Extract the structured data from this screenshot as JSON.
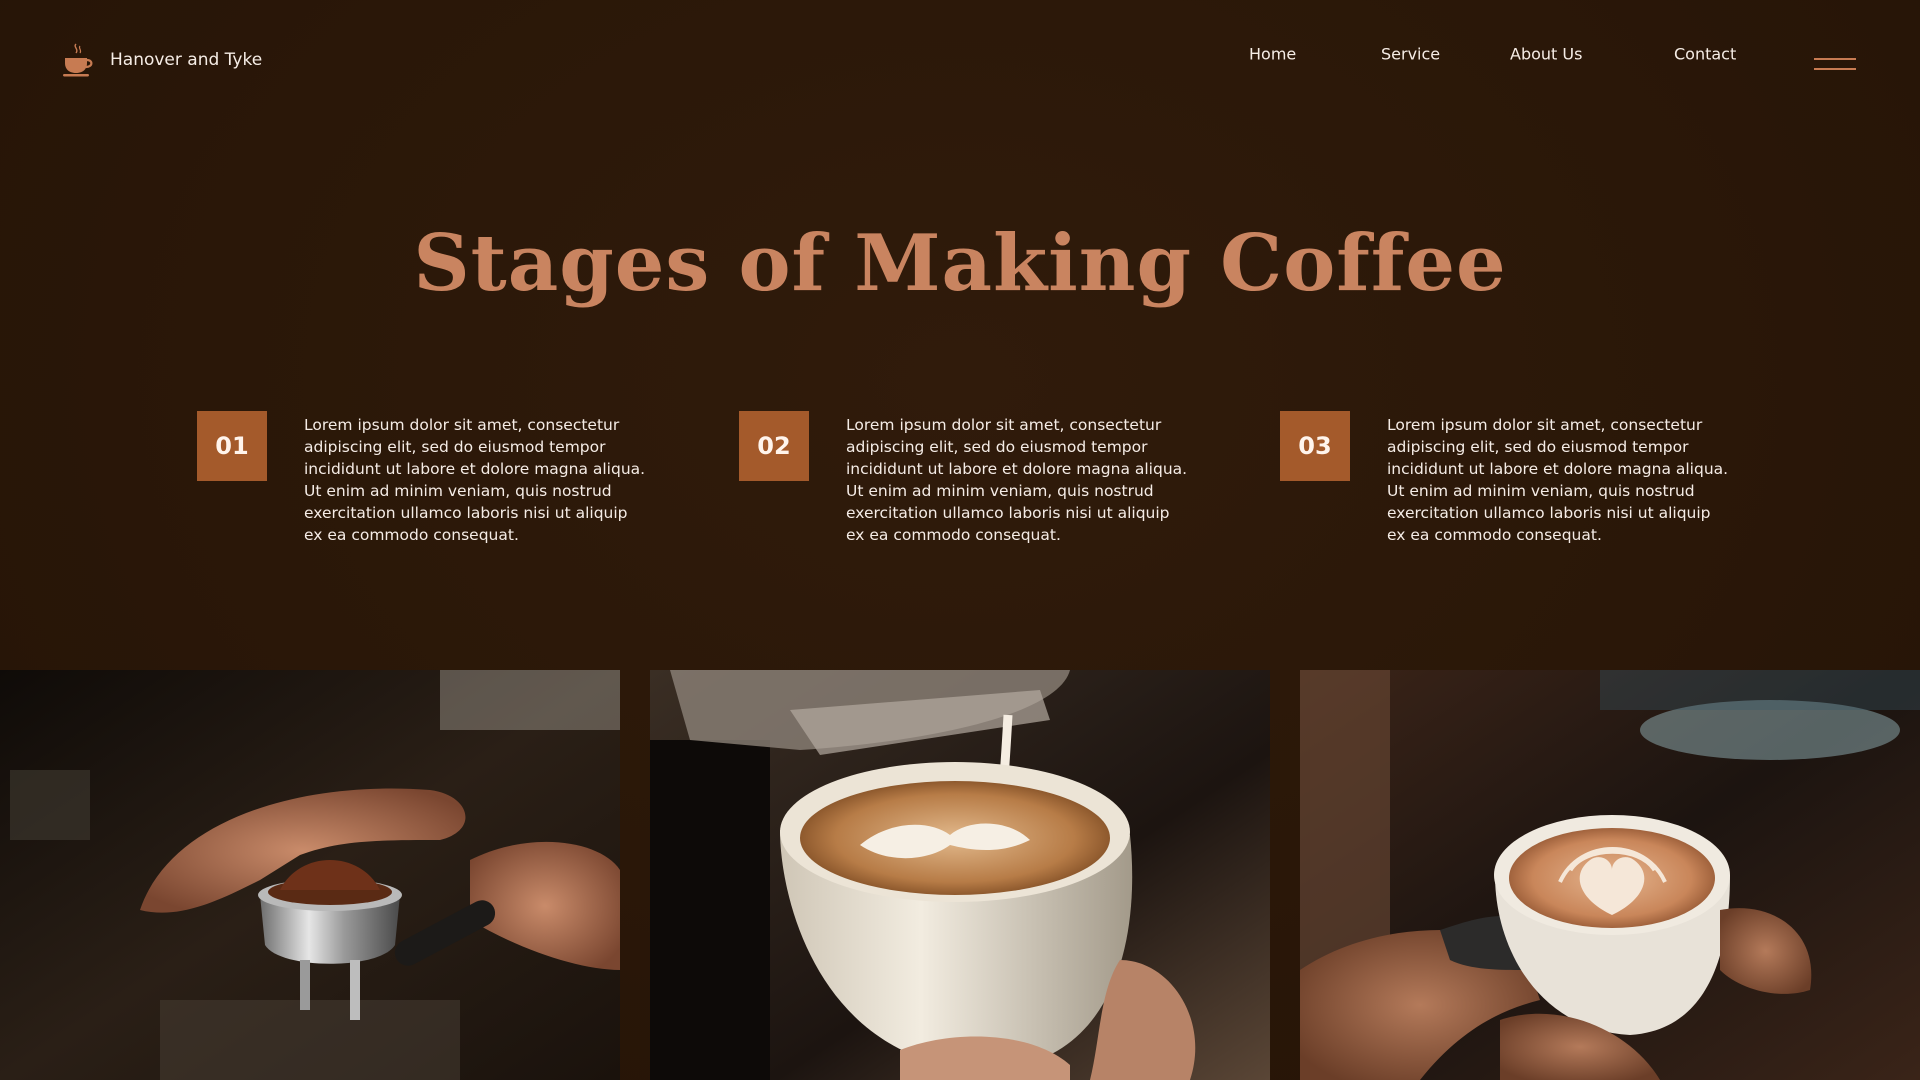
{
  "brand": {
    "name": "Hanover and Tyke",
    "icon": "coffee-cup-icon",
    "icon_color": "#c77b52"
  },
  "nav": {
    "items": [
      {
        "label": "Home"
      },
      {
        "label": "Service"
      },
      {
        "label": "About Us"
      },
      {
        "label": "Contact"
      }
    ],
    "menu_icon": "hamburger-menu-icon"
  },
  "hero": {
    "title": "Stages of Making Coffee",
    "title_color": "#c98460"
  },
  "stages": [
    {
      "number": "01",
      "text": "Lorem ipsum dolor sit amet, consectetur adipiscing elit, sed do eiusmod tempor incididunt ut labore et dolore magna aliqua. Ut enim ad minim veniam, quis nostrud exercitation ullamco laboris nisi ut aliquip ex ea commodo consequat."
    },
    {
      "number": "02",
      "text": "Lorem ipsum dolor sit amet, consectetur adipiscing elit, sed do eiusmod tempor incididunt ut labore et dolore magna aliqua. Ut enim ad minim veniam, quis nostrud exercitation ullamco laboris nisi ut aliquip ex ea commodo consequat."
    },
    {
      "number": "03",
      "text": "Lorem ipsum dolor sit amet, consectetur adipiscing elit, sed do eiusmod tempor incididunt ut labore et dolore magna aliqua. Ut enim ad minim veniam, quis nostrud exercitation ullamco laboris nisi ut aliquip ex ea commodo consequat."
    }
  ],
  "colors": {
    "background": "#2a1709",
    "accent": "#a45a2b",
    "text": "#f6ede6"
  }
}
